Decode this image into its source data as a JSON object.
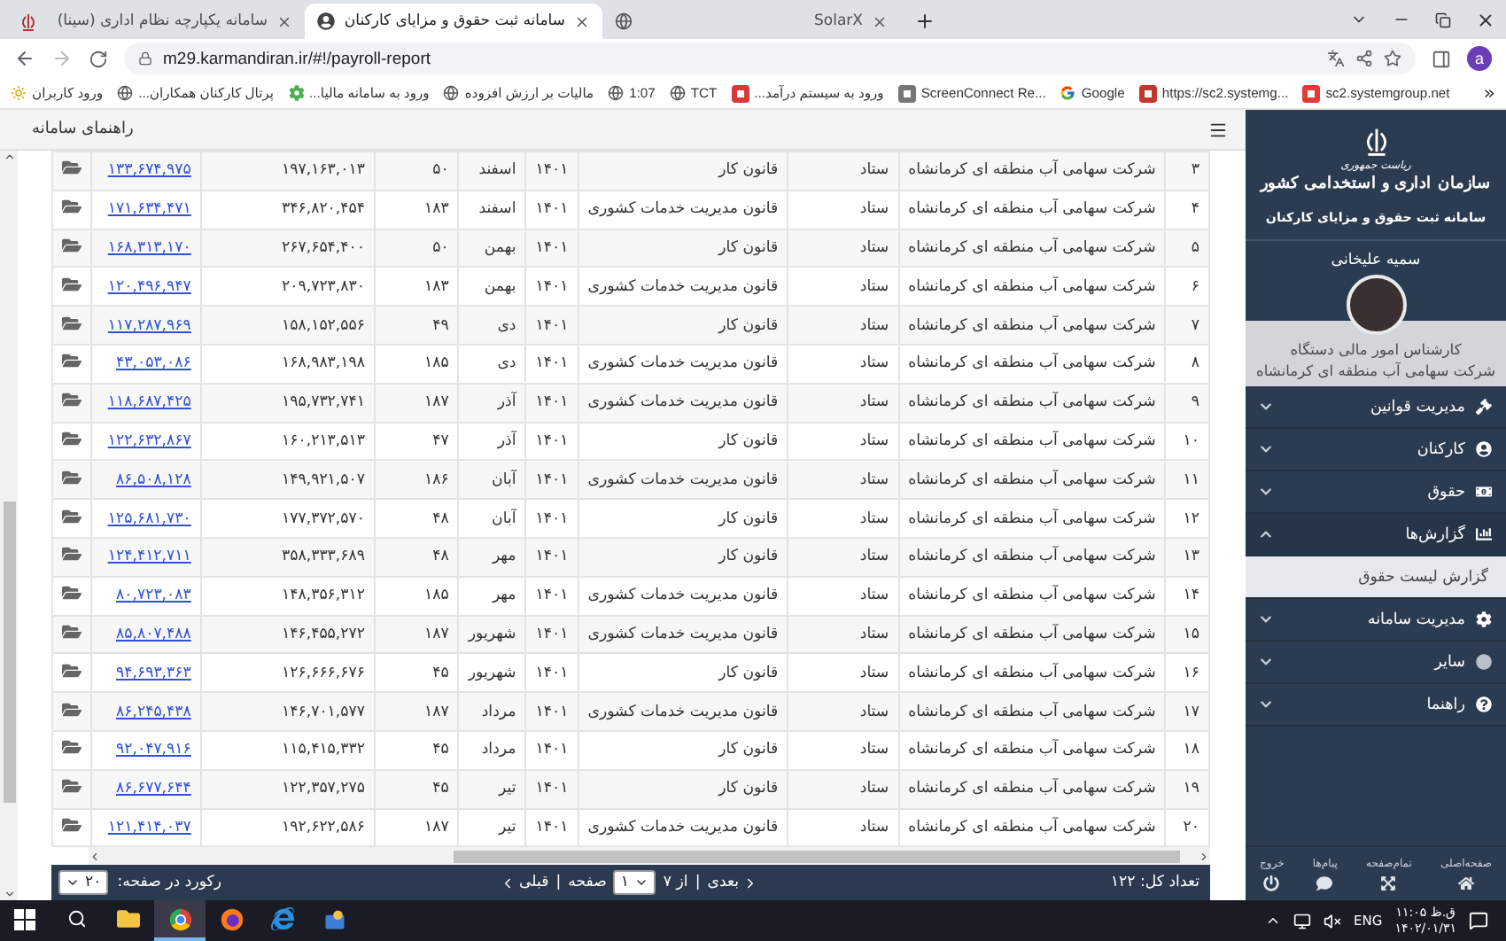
{
  "browser": {
    "tabs": [
      {
        "title": "SolarX",
        "selected": false
      },
      {
        "title": "سامانه ثبت حقوق و مزایای کارکنان",
        "selected": true
      },
      {
        "title": "سامانه یکپارچه نظام اداری (سینا)",
        "selected": false
      }
    ],
    "address": "m29.karmandiran.ir/#!/payroll-report",
    "profile_initial": "a",
    "bookmarks": [
      "sc2.systemgroup.net",
      "https://sc2.systemg...",
      "Google",
      "ScreenConnect Re...",
      "ورود به سیستم درآمد...",
      "TCT",
      "1:07",
      "مالیات بر ارزش افزوده",
      "ورود به سامانه مالیا...",
      "پرتال کارکنان همکاران...",
      "ورود کاربران"
    ],
    "bookmarks_more": "»"
  },
  "header": {
    "title": "راهنمای سامانه"
  },
  "table": {
    "rows": [
      {
        "number": "۳",
        "company": "شرکت سهامی آب منطقه ای کرمانشاه",
        "unit": "ستاد",
        "law": "قانون کار",
        "year": "۱۴۰۱",
        "month": "اسفند",
        "days": "۵۰",
        "amount": "۱۹۷,۱۶۳,۰۱۳",
        "net": "۱۳۳,۶۷۴,۹۷۵"
      },
      {
        "number": "۴",
        "company": "شرکت سهامی آب منطقه ای کرمانشاه",
        "unit": "ستاد",
        "law": "قانون مدیریت خدمات کشوری",
        "year": "۱۴۰۱",
        "month": "اسفند",
        "days": "۱۸۳",
        "amount": "۳۴۶,۸۲۰,۴۵۴",
        "net": "۱۷۱,۶۳۴,۴۷۱"
      },
      {
        "number": "۵",
        "company": "شرکت سهامی آب منطقه ای کرمانشاه",
        "unit": "ستاد",
        "law": "قانون کار",
        "year": "۱۴۰۱",
        "month": "بهمن",
        "days": "۵۰",
        "amount": "۲۶۷,۶۵۴,۴۰۰",
        "net": "۱۶۸,۳۱۳,۱۷۰"
      },
      {
        "number": "۶",
        "company": "شرکت سهامی آب منطقه ای کرمانشاه",
        "unit": "ستاد",
        "law": "قانون مدیریت خدمات کشوری",
        "year": "۱۴۰۱",
        "month": "بهمن",
        "days": "۱۸۳",
        "amount": "۲۰۹,۷۲۳,۸۳۰",
        "net": "۱۲۰,۴۹۶,۹۴۷"
      },
      {
        "number": "۷",
        "company": "شرکت سهامی آب منطقه ای کرمانشاه",
        "unit": "ستاد",
        "law": "قانون کار",
        "year": "۱۴۰۱",
        "month": "دی",
        "days": "۴۹",
        "amount": "۱۵۸,۱۵۲,۵۵۶",
        "net": "۱۱۷,۲۸۷,۹۶۹"
      },
      {
        "number": "۸",
        "company": "شرکت سهامی آب منطقه ای کرمانشاه",
        "unit": "ستاد",
        "law": "قانون مدیریت خدمات کشوری",
        "year": "۱۴۰۱",
        "month": "دی",
        "days": "۱۸۵",
        "amount": "۱۶۸,۹۸۳,۱۹۸",
        "net": "۴۳,۰۵۳,۰۸۶"
      },
      {
        "number": "۹",
        "company": "شرکت سهامی آب منطقه ای کرمانشاه",
        "unit": "ستاد",
        "law": "قانون مدیریت خدمات کشوری",
        "year": "۱۴۰۱",
        "month": "آذر",
        "days": "۱۸۷",
        "amount": "۱۹۵,۷۳۲,۷۴۱",
        "net": "۱۱۸,۶۸۷,۴۲۵"
      },
      {
        "number": "۱۰",
        "company": "شرکت سهامی آب منطقه ای کرمانشاه",
        "unit": "ستاد",
        "law": "قانون کار",
        "year": "۱۴۰۱",
        "month": "آذر",
        "days": "۴۷",
        "amount": "۱۶۰,۲۱۳,۵۱۳",
        "net": "۱۲۲,۶۳۲,۸۶۷"
      },
      {
        "number": "۱۱",
        "company": "شرکت سهامی آب منطقه ای کرمانشاه",
        "unit": "ستاد",
        "law": "قانون مدیریت خدمات کشوری",
        "year": "۱۴۰۱",
        "month": "آبان",
        "days": "۱۸۶",
        "amount": "۱۴۹,۹۲۱,۵۰۷",
        "net": "۸۶,۵۰۸,۱۲۸"
      },
      {
        "number": "۱۲",
        "company": "شرکت سهامی آب منطقه ای کرمانشاه",
        "unit": "ستاد",
        "law": "قانون کار",
        "year": "۱۴۰۱",
        "month": "آبان",
        "days": "۴۸",
        "amount": "۱۷۷,۳۷۲,۵۷۰",
        "net": "۱۲۵,۶۸۱,۷۳۰"
      },
      {
        "number": "۱۳",
        "company": "شرکت سهامی آب منطقه ای کرمانشاه",
        "unit": "ستاد",
        "law": "قانون کار",
        "year": "۱۴۰۱",
        "month": "مهر",
        "days": "۴۸",
        "amount": "۳۵۸,۳۳۳,۶۸۹",
        "net": "۱۲۴,۴۱۲,۷۱۱"
      },
      {
        "number": "۱۴",
        "company": "شرکت سهامی آب منطقه ای کرمانشاه",
        "unit": "ستاد",
        "law": "قانون مدیریت خدمات کشوری",
        "year": "۱۴۰۱",
        "month": "مهر",
        "days": "۱۸۵",
        "amount": "۱۴۸,۳۵۶,۳۱۲",
        "net": "۸۰,۷۲۳,۰۸۳"
      },
      {
        "number": "۱۵",
        "company": "شرکت سهامی آب منطقه ای کرمانشاه",
        "unit": "ستاد",
        "law": "قانون مدیریت خدمات کشوری",
        "year": "۱۴۰۱",
        "month": "شهریور",
        "days": "۱۸۷",
        "amount": "۱۴۶,۴۵۵,۲۷۲",
        "net": "۸۵,۸۰۷,۴۸۸"
      },
      {
        "number": "۱۶",
        "company": "شرکت سهامی آب منطقه ای کرمانشاه",
        "unit": "ستاد",
        "law": "قانون کار",
        "year": "۱۴۰۱",
        "month": "شهریور",
        "days": "۴۵",
        "amount": "۱۲۶,۶۶۶,۶۷۶",
        "net": "۹۴,۶۹۳,۳۶۳"
      },
      {
        "number": "۱۷",
        "company": "شرکت سهامی آب منطقه ای کرمانشاه",
        "unit": "ستاد",
        "law": "قانون مدیریت خدمات کشوری",
        "year": "۱۴۰۱",
        "month": "مرداد",
        "days": "۱۸۷",
        "amount": "۱۴۶,۷۰۱,۵۷۷",
        "net": "۸۶,۲۴۵,۴۳۸"
      },
      {
        "number": "۱۸",
        "company": "شرکت سهامی آب منطقه ای کرمانشاه",
        "unit": "ستاد",
        "law": "قانون کار",
        "year": "۱۴۰۱",
        "month": "مرداد",
        "days": "۴۵",
        "amount": "۱۱۵,۴۱۵,۳۳۲",
        "net": "۹۲,۰۴۷,۹۱۶"
      },
      {
        "number": "۱۹",
        "company": "شرکت سهامی آب منطقه ای کرمانشاه",
        "unit": "ستاد",
        "law": "قانون کار",
        "year": "۱۴۰۱",
        "month": "تیر",
        "days": "۴۵",
        "amount": "۱۲۲,۳۵۷,۲۷۵",
        "net": "۸۶,۶۷۷,۶۴۴"
      },
      {
        "number": "۲۰",
        "company": "شرکت سهامی آب منطقه ای کرمانشاه",
        "unit": "ستاد",
        "law": "قانون مدیریت خدمات کشوری",
        "year": "۱۴۰۱",
        "month": "تیر",
        "days": "۱۸۷",
        "amount": "۱۹۲,۶۲۲,۵۸۶",
        "net": "۱۲۱,۴۱۴,۰۳۷"
      }
    ]
  },
  "footer": {
    "per_page": "۲۰",
    "per_page_label": "رکورد در صفحه:",
    "prev": "قبلی",
    "prev_separator": "|",
    "page_label": "صفحه",
    "page": "۱",
    "of_pages": "از ۷",
    "next_separator": "|",
    "next": "بعدی",
    "total": "تعداد کل: ۱۲۲"
  },
  "sidebar": {
    "agency_top": "ریاست جمهوری",
    "agency": "سازمان اداری و استخدامی کشور",
    "system": "سامانه ثبت حقوق و مزایای کارکنان",
    "user_name": "سمیه علیخانی",
    "role": "کارشناس امور مالی دستگاه",
    "organization": "شرکت سهامی آب منطقه ای کرمانشاه",
    "menu": [
      {
        "label": "مدیریت قوانین",
        "expanded": false
      },
      {
        "label": "کارکنان",
        "expanded": false
      },
      {
        "label": "حقوق",
        "expanded": false
      },
      {
        "label": "گزارش‌ها",
        "expanded": true,
        "children": [
          {
            "label": "گزارش لیست حقوق",
            "selected": true
          }
        ]
      },
      {
        "label": "مدیریت سامانه",
        "expanded": false
      },
      {
        "label": "سایر",
        "expanded": false
      },
      {
        "label": "راهنما",
        "expanded": false
      }
    ],
    "bottom_actions": [
      "صفحه‌اصلی",
      "تمام‌صفحه",
      "پیام‌ها",
      "خروج"
    ]
  },
  "taskbar": {
    "apps": [
      {
        "selected": false
      },
      {
        "selected": true
      },
      {
        "selected": false
      },
      {
        "selected": false
      },
      {
        "selected": false
      }
    ],
    "language": "ENG",
    "time": "ق.ظ ۱۱:۰۵",
    "date": "۱۴۰۲/۰۱/۳۱"
  }
}
